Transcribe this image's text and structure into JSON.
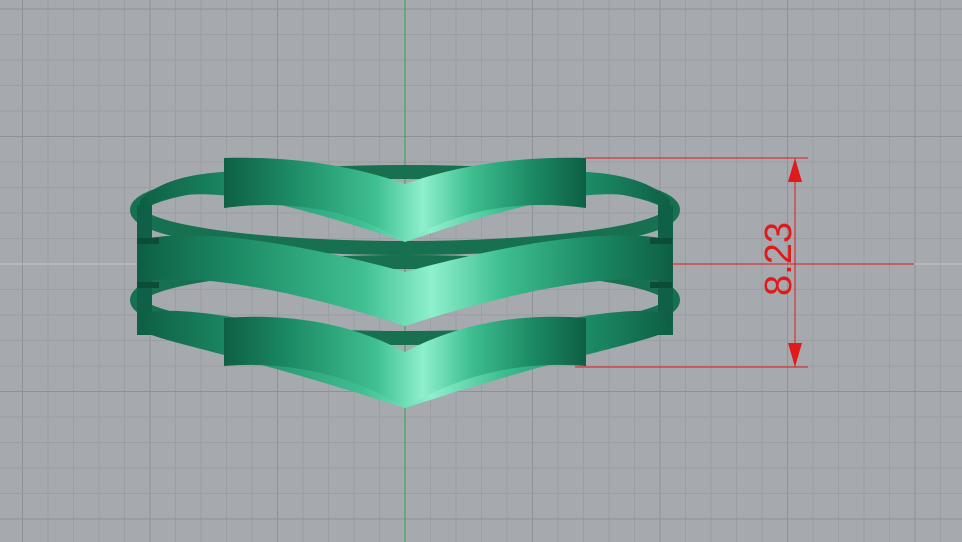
{
  "viewport": {
    "background_color": "#a6a9ae",
    "grid_minor_color": "#9b9ea3",
    "grid_major_color": "#8e9196",
    "axis_y_color": "#2aa84a",
    "axis_x_color": "#b8bbbf"
  },
  "model": {
    "body_color": "#1f8f6a",
    "highlight_color": "#7fe9c4",
    "shadow_color": "#0d5a40"
  },
  "dimension": {
    "value": "8.23",
    "color": "#e01a1a"
  }
}
